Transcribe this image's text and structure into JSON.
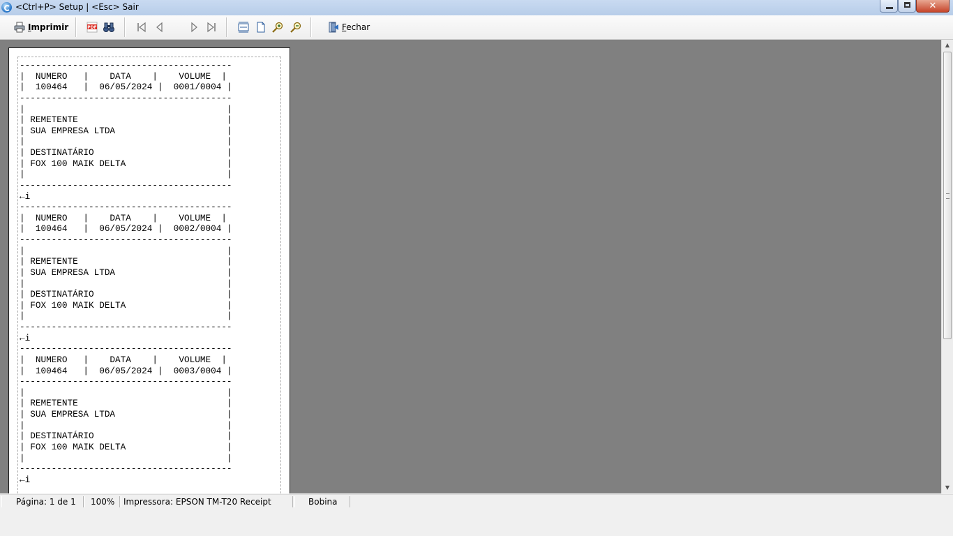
{
  "window": {
    "title": "<Ctrl+P> Setup | <Esc> Sair"
  },
  "toolbar": {
    "print_label": "Imprimir",
    "close_label": "Fechar"
  },
  "receipt_text": "----------------------------------------\n|  NUMERO   |    DATA    |    VOLUME  |\n|  100464   |  06/05/2024 |  0001/0004 |\n----------------------------------------\n|                                      |\n| REMETENTE                            |\n| SUA EMPRESA LTDA                     |\n|                                      |\n| DESTINATÁRIO                         |\n| FOX 100 MAIK DELTA                   |\n|                                      |\n----------------------------------------\n←i\n----------------------------------------\n|  NUMERO   |    DATA    |    VOLUME  |\n|  100464   |  06/05/2024 |  0002/0004 |\n----------------------------------------\n|                                      |\n| REMETENTE                            |\n| SUA EMPRESA LTDA                     |\n|                                      |\n| DESTINATÁRIO                         |\n| FOX 100 MAIK DELTA                   |\n|                                      |\n----------------------------------------\n←i\n----------------------------------------\n|  NUMERO   |    DATA    |    VOLUME  |\n|  100464   |  06/05/2024 |  0003/0004 |\n----------------------------------------\n|                                      |\n| REMETENTE                            |\n| SUA EMPRESA LTDA                     |\n|                                      |\n| DESTINATÁRIO                         |\n| FOX 100 MAIK DELTA                   |\n|                                      |\n----------------------------------------\n←i",
  "statusbar": {
    "page": "Página: 1 de 1",
    "zoom": "100%",
    "printer": "Impressora: EPSON TM-T20 Receipt",
    "mode": "Bobina"
  },
  "icons": {
    "app": "preview-app-icon",
    "print": "printer-icon",
    "pdf": "pdf-icon",
    "find": "binoculars-icon",
    "first": "first-page-icon",
    "prev": "previous-page-icon",
    "next": "next-page-icon",
    "last": "last-page-icon",
    "page_width": "page-width-icon",
    "whole_page": "whole-page-icon",
    "zoom_in": "zoom-in-icon",
    "zoom_out": "zoom-out-icon",
    "close": "exit-door-icon"
  }
}
